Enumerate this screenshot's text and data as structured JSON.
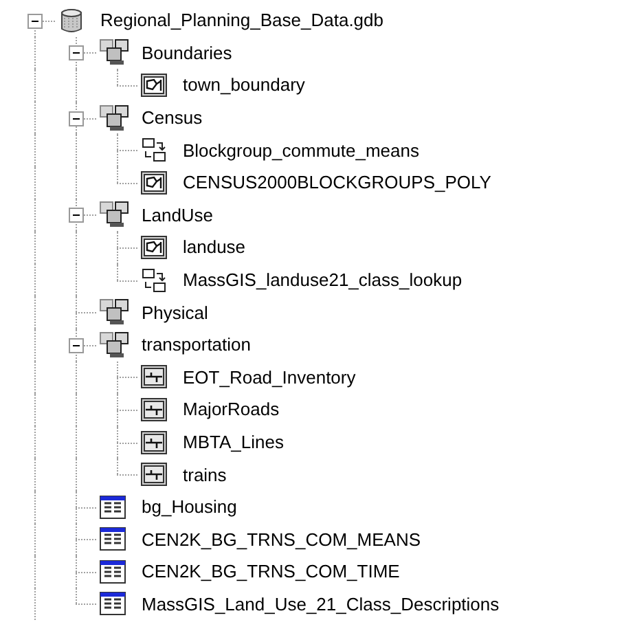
{
  "tree": [
    {
      "label": "Regional_Planning_Base_Data.gdb",
      "kind": "database",
      "expanded": true,
      "children": [
        {
          "label": "Boundaries",
          "kind": "dataset",
          "expanded": true,
          "children": [
            {
              "label": "town_boundary",
              "kind": "polygon"
            }
          ]
        },
        {
          "label": "Census",
          "kind": "dataset",
          "expanded": true,
          "children": [
            {
              "label": "Blockgroup_commute_means",
              "kind": "relationship"
            },
            {
              "label": "CENSUS2000BLOCKGROUPS_POLY",
              "kind": "polygon"
            }
          ]
        },
        {
          "label": "LandUse",
          "kind": "dataset",
          "expanded": true,
          "children": [
            {
              "label": "landuse",
              "kind": "polygon"
            },
            {
              "label": "MassGIS_landuse21_class_lookup",
              "kind": "relationship"
            }
          ]
        },
        {
          "label": "Physical",
          "kind": "dataset"
        },
        {
          "label": "transportation",
          "kind": "dataset",
          "expanded": true,
          "children": [
            {
              "label": "EOT_Road_Inventory",
              "kind": "line"
            },
            {
              "label": "MajorRoads",
              "kind": "line"
            },
            {
              "label": "MBTA_Lines",
              "kind": "line"
            },
            {
              "label": "trains",
              "kind": "line"
            }
          ]
        },
        {
          "label": "bg_Housing",
          "kind": "table"
        },
        {
          "label": "CEN2K_BG_TRNS_COM_MEANS",
          "kind": "table"
        },
        {
          "label": "CEN2K_BG_TRNS_COM_TIME",
          "kind": "table"
        },
        {
          "label": "MassGIS_Land_Use_21_Class_Descriptions",
          "kind": "table"
        }
      ]
    }
  ]
}
